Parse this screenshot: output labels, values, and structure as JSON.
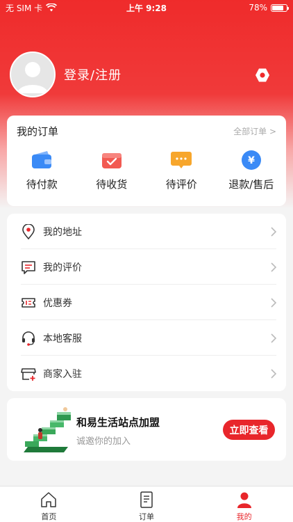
{
  "status_bar": {
    "carrier": "无 SIM 卡",
    "time": "上午 9:28",
    "battery": "78%",
    "battery_level": 0.78
  },
  "profile": {
    "login_label": "登录/注册",
    "settings_icon": "settings-hexagon-icon"
  },
  "orders": {
    "title": "我的订单",
    "all_label": "全部订单 >",
    "items": [
      {
        "label": "待付款",
        "icon": "wallet-icon",
        "color": "#3a8af6"
      },
      {
        "label": "待收货",
        "icon": "parcel-box-icon",
        "color": "#f25a52"
      },
      {
        "label": "待评价",
        "icon": "comment-bubble-icon",
        "color": "#f7a62c"
      },
      {
        "label": "退款/售后",
        "icon": "yuan-coin-icon",
        "color": "#3a8af6"
      }
    ]
  },
  "menu": {
    "items": [
      {
        "label": "我的地址",
        "icon": "location-pin-icon"
      },
      {
        "label": "我的评价",
        "icon": "comment-icon"
      },
      {
        "label": "优惠券",
        "icon": "coupon-icon"
      },
      {
        "label": "本地客服",
        "icon": "headset-icon"
      },
      {
        "label": "商家入驻",
        "icon": "shop-plus-icon"
      }
    ]
  },
  "promo": {
    "title": "和易生活站点加盟",
    "subtitle": "诚邀你的加入",
    "button": "立即查看"
  },
  "tabbar": {
    "items": [
      {
        "label": "首页",
        "icon": "home-icon",
        "active": false
      },
      {
        "label": "订单",
        "icon": "order-list-icon",
        "active": false
      },
      {
        "label": "我的",
        "icon": "user-icon",
        "active": true
      }
    ]
  },
  "colors": {
    "brand": "#e8262b",
    "hero": "#ef2b2b"
  }
}
